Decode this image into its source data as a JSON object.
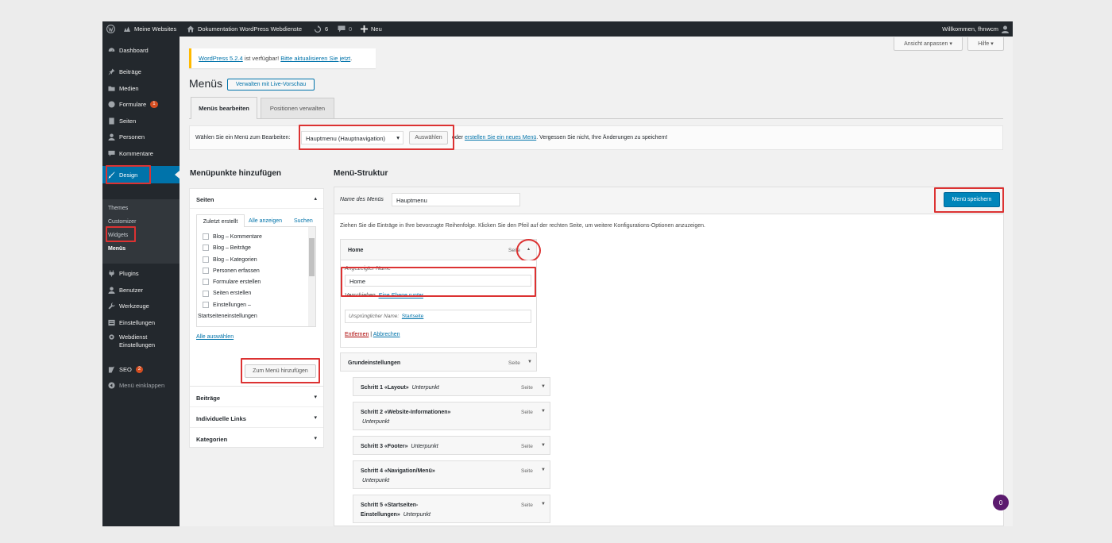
{
  "adminbar": {
    "site": "Meine Websites",
    "docs": "Dokumentation WordPress Webdienste",
    "updates": "6",
    "comments": "0",
    "new": "Neu",
    "welcome": "Willkommen, fhnwcm"
  },
  "sidebar": {
    "items": [
      "Dashboard",
      "Beiträge",
      "Medien",
      "Formulare",
      "Seiten",
      "Personen",
      "Kommentare",
      "Design",
      "Plugins",
      "Benutzer",
      "Werkzeuge",
      "Einstellungen",
      "Webdienst",
      "Einstellungen",
      "SEO",
      "Menü einklappen"
    ],
    "formulare_badge": "1",
    "seo_badge": "2",
    "submenu": [
      "Themes",
      "Customizer",
      "Widgets",
      "Menüs"
    ]
  },
  "screen": {
    "options": "Ansicht anpassen",
    "help": "Hilfe"
  },
  "notice": {
    "version": "WordPress 5.2.4",
    "text": " ist verfügbar! ",
    "update": "Bitte aktualisieren Sie jetzt",
    "end": "."
  },
  "page": {
    "title": "Menüs",
    "live": "Verwalten mit Live-Vorschau"
  },
  "tabs": [
    "Menüs bearbeiten",
    "Positionen verwalten"
  ],
  "select": {
    "label": "Wählen Sie ein Menü zum Bearbeiten:",
    "value": "Hauptmenu (Hauptnavigation)",
    "button": "Auswählen",
    "or": "oder ",
    "create": "erstellen Sie ein neues Menü",
    "rest": ". Vergessen Sie nicht, Ihre Änderungen zu speichern!"
  },
  "left": {
    "title": "Menüpunkte hinzufügen",
    "seiten": "Seiten",
    "subtabs": [
      "Zuletzt erstellt",
      "Alle anzeigen",
      "Suchen"
    ],
    "pages": [
      "Blog – Kommentare",
      "Blog – Beiträge",
      "Blog – Kategorien",
      "Personen erfassen",
      "Formulare erstellen",
      "Seiten erstellen",
      "Einstellungen –"
    ],
    "pages_extra": "Startseiteneinstellungen",
    "select_all": "Alle auswählen",
    "add": "Zum Menü hinzufügen",
    "sections": [
      "Beiträge",
      "Individuelle Links",
      "Kategorien"
    ]
  },
  "right": {
    "title": "Menü-Struktur",
    "name_label": "Name des Menüs",
    "name_value": "Hauptmenu",
    "save": "Menü speichern",
    "hint": "Ziehen Sie die Einträge in Ihre bevorzugte Reihenfolge. Klicken Sie den Pfeil auf der rechten Seite, um weitere Konfigurations-Optionen anzuzeigen.",
    "home": {
      "title": "Home",
      "type": "Seite",
      "nav_label": "Angezeigter Name",
      "nav_value": "Home",
      "move": "Verschieben",
      "move_link": "Eine Ebene runter",
      "orig_label": "Ursprünglicher Name:",
      "orig_link": "Startseite",
      "remove": "Entfernen",
      "sep": " | ",
      "cancel": "Abbrechen"
    },
    "items": [
      {
        "title": "Grundeinstellungen",
        "sub": "",
        "type": "Seite"
      },
      {
        "title": "Schritt 1 «Layout»",
        "sub": "Unterpunkt",
        "type": "Seite"
      },
      {
        "title": "Schritt 2 «Website-Informationen»",
        "sub": "Unterpunkt",
        "type": "Seite"
      },
      {
        "title": "Schritt 3 «Footer»",
        "sub": "Unterpunkt",
        "type": "Seite"
      },
      {
        "title": "Schritt 4 «Navigation/Menü»",
        "sub": "Unterpunkt",
        "type": "Seite"
      },
      {
        "title": "Schritt 5 «Startseiten-",
        "title2": "Einstellungen»",
        "sub": "Unterpunkt",
        "type": "Seite"
      }
    ]
  },
  "bubble": "0",
  "colors": {
    "adminbar": "#23282d",
    "accent": "#0073aa",
    "highlight": "#dc3232",
    "active": "#0073aa",
    "bubble": "#5b1a6e"
  }
}
